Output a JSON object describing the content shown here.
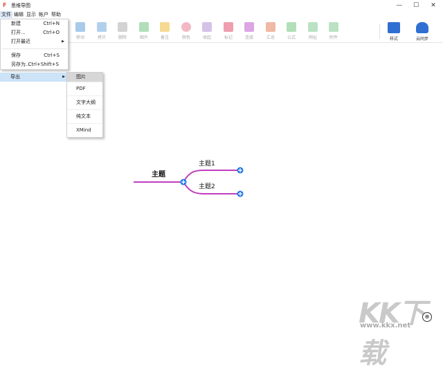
{
  "window": {
    "title": "思维导图",
    "minimize": "—",
    "maximize": "☐",
    "close": "✕"
  },
  "menubar": [
    "文件",
    "编辑",
    "显示",
    "帐户",
    "帮助"
  ],
  "toolbar": {
    "items": [
      {
        "label": "移动",
        "icon": "move-icon",
        "color": "#6ea8e0"
      },
      {
        "label": "拷贝",
        "icon": "copy-icon",
        "color": "#7fb0e0"
      },
      {
        "label": "删除",
        "icon": "trash-icon",
        "color": "#b5b5b5"
      },
      {
        "label": "图片",
        "icon": "image-icon",
        "color": "#7cc98a"
      },
      {
        "label": "备注",
        "icon": "note-icon",
        "color": "#f0c24a"
      },
      {
        "label": "颜色",
        "icon": "palette-icon",
        "color": "#e98a9c"
      },
      {
        "label": "收起",
        "icon": "collapse-icon",
        "color": "#b89ad8"
      },
      {
        "label": "标记",
        "icon": "flag-icon",
        "color": "#e35d7a"
      },
      {
        "label": "连接",
        "icon": "connect-icon",
        "color": "#c56ad1"
      },
      {
        "label": "汇总",
        "icon": "summary-icon",
        "color": "#e48a6a"
      },
      {
        "label": "公式",
        "icon": "formula-icon",
        "color": "#7dc98a"
      },
      {
        "label": "网址",
        "icon": "link-icon",
        "color": "#8ccf9a"
      },
      {
        "label": "附件",
        "icon": "attachment-icon",
        "color": "#8ccf9a"
      }
    ],
    "style_label": "样式",
    "cloud_label": "云同步"
  },
  "file_menu": {
    "new": {
      "label": "新建",
      "shortcut": "Ctrl+N"
    },
    "open": {
      "label": "打开...",
      "shortcut": "Ctrl+O"
    },
    "recent": {
      "label": "打开最近"
    },
    "save": {
      "label": "保存",
      "shortcut": "Ctrl+S"
    },
    "save_as": {
      "label": "另存为...",
      "shortcut": "Ctrl+Shift+S"
    },
    "export": {
      "label": "导出"
    }
  },
  "export_submenu": [
    "图片",
    "PDF",
    "文字大纲",
    "纯文本",
    "XMind"
  ],
  "mindmap": {
    "root": "主题",
    "children": [
      "主题1",
      "主题2"
    ],
    "branch_color": "#c03dbd",
    "expand_color": "#1a73e8"
  },
  "watermark": {
    "text": "KK下载",
    "url": "www.kkx.net"
  }
}
